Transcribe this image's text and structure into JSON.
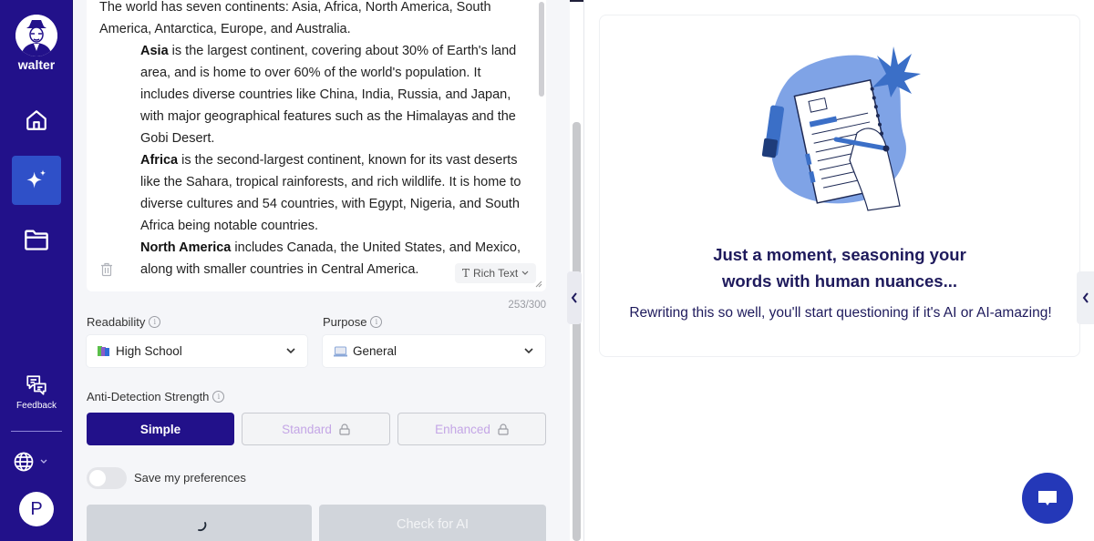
{
  "sidebar": {
    "brand": "walter",
    "nav": [
      {
        "name": "home",
        "icon": "home-icon"
      },
      {
        "name": "humanizer",
        "icon": "sparkles-icon",
        "active": true
      },
      {
        "name": "documents",
        "icon": "folder-icon"
      }
    ],
    "feedback_label": "Feedback",
    "language_icon": "globe-icon",
    "avatar_initial": "P"
  },
  "editor": {
    "paragraphs": [
      {
        "bold": "",
        "text": "The world has seven continents: Asia, Africa, North America, South America, Antarctica, Europe, and Australia.",
        "indent": false
      },
      {
        "bold": "Asia",
        "text": " is the largest continent, covering about 30% of Earth's land area, and is home to over 60% of the world's population. It includes diverse countries like China, India, Russia, and Japan, with major geographical features such as the Himalayas and the Gobi Desert.",
        "indent": true
      },
      {
        "bold": "Africa",
        "text": " is the second-largest continent, known for its vast deserts like the Sahara, tropical rainforests, and rich wildlife. It is home to diverse cultures and 54 countries, with Egypt, Nigeria, and South Africa being notable countries.",
        "indent": true
      },
      {
        "bold": "North America",
        "text": " includes Canada, the United States, and Mexico, along with smaller countries in Central America.",
        "indent": true
      }
    ],
    "format_label": "Rich Text",
    "char_count": "253/300"
  },
  "settings": {
    "readability": {
      "label": "Readability",
      "value": "High School"
    },
    "purpose": {
      "label": "Purpose",
      "value": "General"
    },
    "strength": {
      "label": "Anti-Detection Strength",
      "options": [
        {
          "label": "Simple",
          "active": true,
          "locked": false
        },
        {
          "label": "Standard",
          "active": false,
          "locked": true
        },
        {
          "label": "Enhanced",
          "active": false,
          "locked": true
        }
      ]
    },
    "save_prefs_label": "Save my preferences",
    "save_prefs_on": false
  },
  "actions": {
    "humanize_loading": true,
    "check_ai_label": "Check for AI"
  },
  "result": {
    "title_line1": "Just a moment, seasoning your",
    "title_line2": "words with human nuances...",
    "subtitle": "Rewriting this so well, you'll start questioning if it's AI or AI-amazing!"
  },
  "colors": {
    "sidebar_bg": "#22118a",
    "active_nav": "#2f50c8",
    "primary_button": "#22118a",
    "chat_fab": "#2438b8",
    "illustration_blue": "#7fa3e6"
  }
}
